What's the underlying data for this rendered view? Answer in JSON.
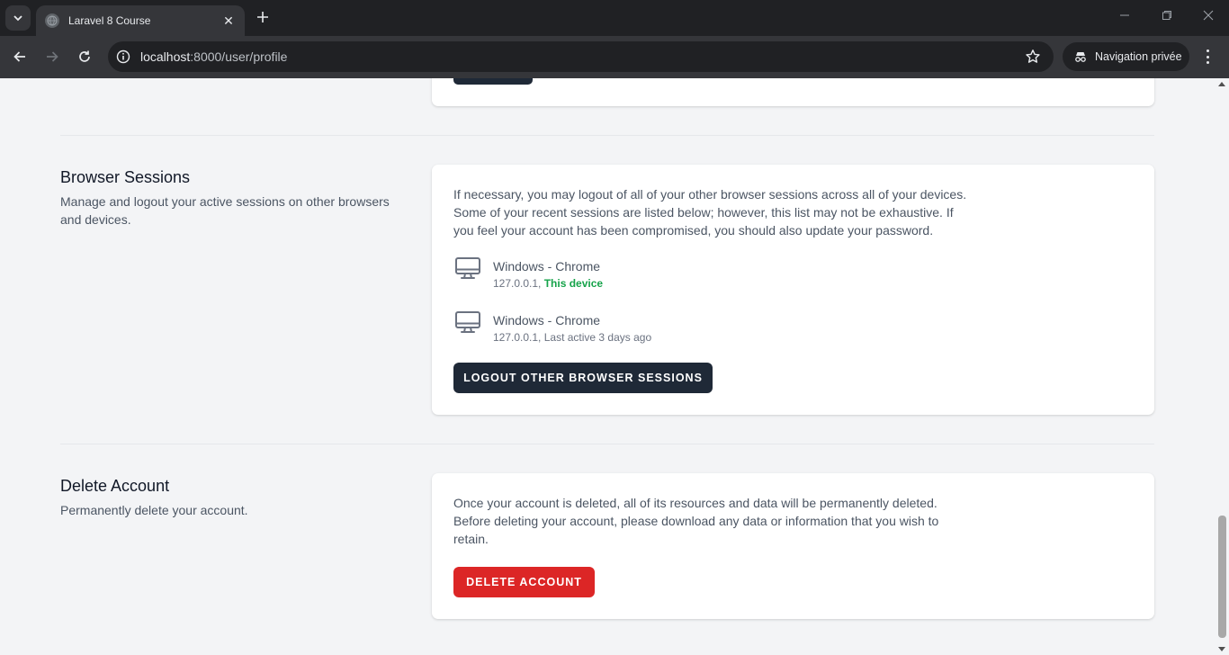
{
  "browser": {
    "tab_title": "Laravel 8 Course",
    "url_host": "localhost",
    "url_rest": ":8000/user/profile",
    "incognito_label": "Navigation privée",
    "icons": [
      "tab-search-icon",
      "close-icon",
      "plus-icon",
      "minimize-icon",
      "restore-icon",
      "close-window-icon",
      "back-icon",
      "forward-icon",
      "reload-icon",
      "info-icon",
      "star-icon",
      "incognito-icon",
      "more-icon"
    ]
  },
  "browser_sessions": {
    "title": "Browser Sessions",
    "description": "Manage and logout your active sessions on other browsers and devices.",
    "intro": "If necessary, you may logout of all of your other browser sessions across all of your devices. Some of your recent sessions are listed below; however, this list may not be exhaustive. If you feel your account has been compromised, you should also update your password.",
    "sessions": [
      {
        "platform": "Windows - Chrome",
        "ip": "127.0.0.1, ",
        "status": "This device",
        "current": true
      },
      {
        "platform": "Windows - Chrome",
        "ip": "127.0.0.1, ",
        "status": "Last active 3 days ago",
        "current": false
      }
    ],
    "logout_button": "Logout Other Browser Sessions"
  },
  "delete_account": {
    "title": "Delete Account",
    "description": "Permanently delete your account.",
    "warning": "Once your account is deleted, all of its resources and data will be permanently deleted. Before deleting your account, please download any data or information that you wish to retain.",
    "delete_button": "Delete Account"
  },
  "colors": {
    "primary_button": "#1f2937",
    "danger_button": "#dc2626",
    "current_device": "#16a34a"
  }
}
